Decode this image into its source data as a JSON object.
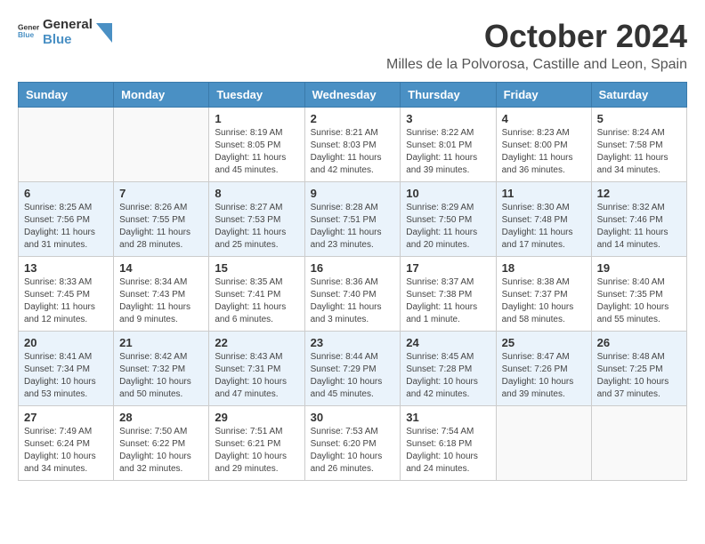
{
  "header": {
    "logo_general": "General",
    "logo_blue": "Blue",
    "title": "October 2024",
    "subtitle": "Milles de la Polvorosa, Castille and Leon, Spain"
  },
  "weekdays": [
    "Sunday",
    "Monday",
    "Tuesday",
    "Wednesday",
    "Thursday",
    "Friday",
    "Saturday"
  ],
  "weeks": [
    [
      {
        "day": "",
        "info": ""
      },
      {
        "day": "",
        "info": ""
      },
      {
        "day": "1",
        "info": "Sunrise: 8:19 AM\nSunset: 8:05 PM\nDaylight: 11 hours and 45 minutes."
      },
      {
        "day": "2",
        "info": "Sunrise: 8:21 AM\nSunset: 8:03 PM\nDaylight: 11 hours and 42 minutes."
      },
      {
        "day": "3",
        "info": "Sunrise: 8:22 AM\nSunset: 8:01 PM\nDaylight: 11 hours and 39 minutes."
      },
      {
        "day": "4",
        "info": "Sunrise: 8:23 AM\nSunset: 8:00 PM\nDaylight: 11 hours and 36 minutes."
      },
      {
        "day": "5",
        "info": "Sunrise: 8:24 AM\nSunset: 7:58 PM\nDaylight: 11 hours and 34 minutes."
      }
    ],
    [
      {
        "day": "6",
        "info": "Sunrise: 8:25 AM\nSunset: 7:56 PM\nDaylight: 11 hours and 31 minutes."
      },
      {
        "day": "7",
        "info": "Sunrise: 8:26 AM\nSunset: 7:55 PM\nDaylight: 11 hours and 28 minutes."
      },
      {
        "day": "8",
        "info": "Sunrise: 8:27 AM\nSunset: 7:53 PM\nDaylight: 11 hours and 25 minutes."
      },
      {
        "day": "9",
        "info": "Sunrise: 8:28 AM\nSunset: 7:51 PM\nDaylight: 11 hours and 23 minutes."
      },
      {
        "day": "10",
        "info": "Sunrise: 8:29 AM\nSunset: 7:50 PM\nDaylight: 11 hours and 20 minutes."
      },
      {
        "day": "11",
        "info": "Sunrise: 8:30 AM\nSunset: 7:48 PM\nDaylight: 11 hours and 17 minutes."
      },
      {
        "day": "12",
        "info": "Sunrise: 8:32 AM\nSunset: 7:46 PM\nDaylight: 11 hours and 14 minutes."
      }
    ],
    [
      {
        "day": "13",
        "info": "Sunrise: 8:33 AM\nSunset: 7:45 PM\nDaylight: 11 hours and 12 minutes."
      },
      {
        "day": "14",
        "info": "Sunrise: 8:34 AM\nSunset: 7:43 PM\nDaylight: 11 hours and 9 minutes."
      },
      {
        "day": "15",
        "info": "Sunrise: 8:35 AM\nSunset: 7:41 PM\nDaylight: 11 hours and 6 minutes."
      },
      {
        "day": "16",
        "info": "Sunrise: 8:36 AM\nSunset: 7:40 PM\nDaylight: 11 hours and 3 minutes."
      },
      {
        "day": "17",
        "info": "Sunrise: 8:37 AM\nSunset: 7:38 PM\nDaylight: 11 hours and 1 minute."
      },
      {
        "day": "18",
        "info": "Sunrise: 8:38 AM\nSunset: 7:37 PM\nDaylight: 10 hours and 58 minutes."
      },
      {
        "day": "19",
        "info": "Sunrise: 8:40 AM\nSunset: 7:35 PM\nDaylight: 10 hours and 55 minutes."
      }
    ],
    [
      {
        "day": "20",
        "info": "Sunrise: 8:41 AM\nSunset: 7:34 PM\nDaylight: 10 hours and 53 minutes."
      },
      {
        "day": "21",
        "info": "Sunrise: 8:42 AM\nSunset: 7:32 PM\nDaylight: 10 hours and 50 minutes."
      },
      {
        "day": "22",
        "info": "Sunrise: 8:43 AM\nSunset: 7:31 PM\nDaylight: 10 hours and 47 minutes."
      },
      {
        "day": "23",
        "info": "Sunrise: 8:44 AM\nSunset: 7:29 PM\nDaylight: 10 hours and 45 minutes."
      },
      {
        "day": "24",
        "info": "Sunrise: 8:45 AM\nSunset: 7:28 PM\nDaylight: 10 hours and 42 minutes."
      },
      {
        "day": "25",
        "info": "Sunrise: 8:47 AM\nSunset: 7:26 PM\nDaylight: 10 hours and 39 minutes."
      },
      {
        "day": "26",
        "info": "Sunrise: 8:48 AM\nSunset: 7:25 PM\nDaylight: 10 hours and 37 minutes."
      }
    ],
    [
      {
        "day": "27",
        "info": "Sunrise: 7:49 AM\nSunset: 6:24 PM\nDaylight: 10 hours and 34 minutes."
      },
      {
        "day": "28",
        "info": "Sunrise: 7:50 AM\nSunset: 6:22 PM\nDaylight: 10 hours and 32 minutes."
      },
      {
        "day": "29",
        "info": "Sunrise: 7:51 AM\nSunset: 6:21 PM\nDaylight: 10 hours and 29 minutes."
      },
      {
        "day": "30",
        "info": "Sunrise: 7:53 AM\nSunset: 6:20 PM\nDaylight: 10 hours and 26 minutes."
      },
      {
        "day": "31",
        "info": "Sunrise: 7:54 AM\nSunset: 6:18 PM\nDaylight: 10 hours and 24 minutes."
      },
      {
        "day": "",
        "info": ""
      },
      {
        "day": "",
        "info": ""
      }
    ]
  ]
}
